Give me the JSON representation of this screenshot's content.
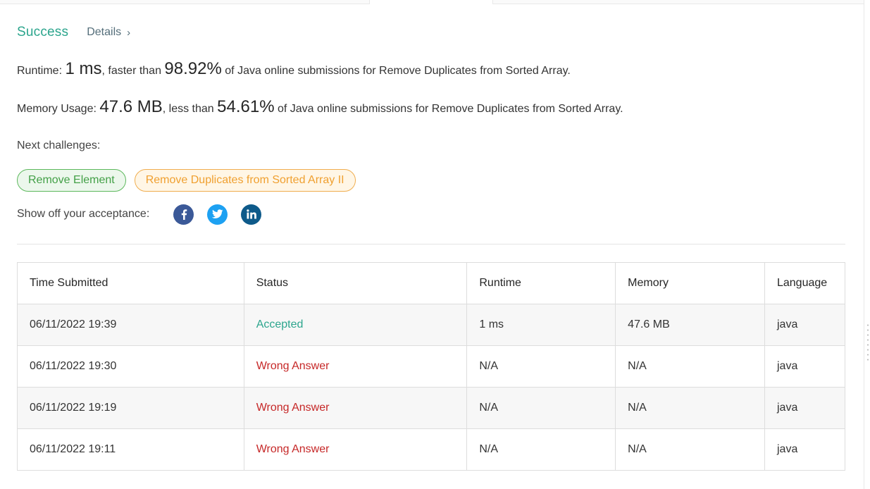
{
  "result": {
    "status": "Success",
    "details_link": "Details",
    "details_chevron": "›"
  },
  "runtime": {
    "label": "Runtime: ",
    "value": "1 ms",
    "comparison": ", faster than ",
    "percent": "98.92%",
    "suffix": " of Java online submissions for Remove Duplicates from Sorted Array."
  },
  "memory": {
    "label": "Memory Usage: ",
    "value": "47.6 MB",
    "comparison": ", less than ",
    "percent": "54.61%",
    "suffix": " of Java online submissions for Remove Duplicates from Sorted Array."
  },
  "next_challenges": {
    "label": "Next challenges:",
    "items": [
      {
        "label": "Remove Element",
        "difficulty": "easy"
      },
      {
        "label": "Remove Duplicates from Sorted Array II",
        "difficulty": "medium"
      }
    ]
  },
  "share": {
    "label": "Show off your acceptance:",
    "icons": [
      "facebook-icon",
      "twitter-icon",
      "linkedin-icon"
    ]
  },
  "table": {
    "headers": [
      "Time Submitted",
      "Status",
      "Runtime",
      "Memory",
      "Language"
    ],
    "rows": [
      [
        "06/11/2022 19:39",
        "Accepted",
        "1 ms",
        "47.6 MB",
        "java"
      ],
      [
        "06/11/2022 19:30",
        "Wrong Answer",
        "N/A",
        "N/A",
        "java"
      ],
      [
        "06/11/2022 19:19",
        "Wrong Answer",
        "N/A",
        "N/A",
        "java"
      ],
      [
        "06/11/2022 19:11",
        "Wrong Answer",
        "N/A",
        "N/A",
        "java"
      ]
    ]
  },
  "colors": {
    "success": "#2ca58d",
    "wrong": "#c62828",
    "easy": "#43a047",
    "medium": "#f0a030"
  }
}
